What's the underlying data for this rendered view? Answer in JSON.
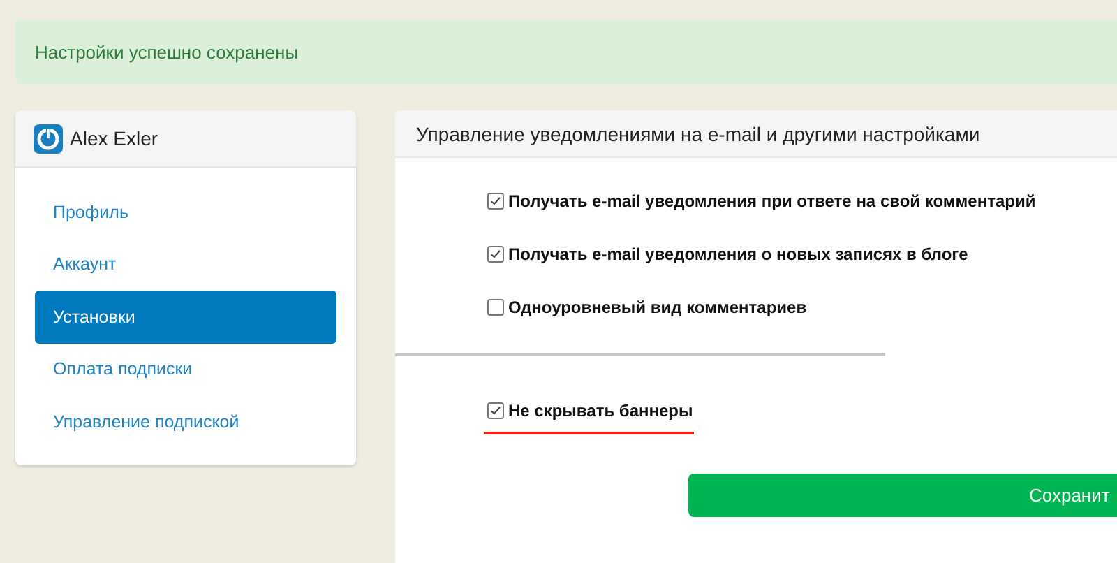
{
  "alert": {
    "text": "Настройки успешно сохранены"
  },
  "sidebar": {
    "user": "Alex Exler",
    "items": [
      {
        "label": "Профиль",
        "selected": false
      },
      {
        "label": "Аккаунт",
        "selected": false
      },
      {
        "label": "Установки",
        "selected": true
      },
      {
        "label": "Оплата подписки",
        "selected": false
      },
      {
        "label": "Управление подпиской",
        "selected": false
      }
    ]
  },
  "panel": {
    "title": "Управление уведомлениями на e-mail и другими настройками",
    "notification_options": [
      {
        "label": "Получать e-mail уведомления при ответе на свой комментарий",
        "checked": true,
        "underlined": false
      },
      {
        "label": "Получать e-mail уведомления о новых записях в блоге",
        "checked": true,
        "underlined": false
      },
      {
        "label": "Одноуровневый вид комментариев",
        "checked": false,
        "underlined": false
      }
    ],
    "banner_options": [
      {
        "label": "Не скрывать баннеры",
        "checked": true,
        "underlined": true
      }
    ],
    "save_button": "Сохранит"
  }
}
